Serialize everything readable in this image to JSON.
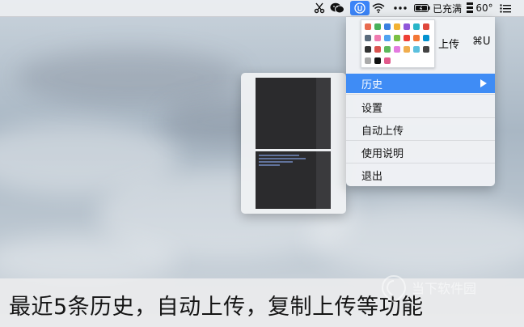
{
  "menubar": {
    "battery_status": "已充满",
    "temperature": "60°",
    "icons": [
      "scissors-icon",
      "wechat-icon",
      "uploader-app-icon",
      "wifi-icon",
      "more-dots-icon",
      "battery-icon",
      "weather-app-icon",
      "list-menu-icon"
    ]
  },
  "menu": {
    "upload_label": "上传",
    "upload_shortcut": "⌘U",
    "items": [
      {
        "label": "历史",
        "selected": true,
        "has_submenu": true
      },
      {
        "label": "设置"
      },
      {
        "label": "自动上传"
      },
      {
        "label": "使用说明"
      },
      {
        "label": "退出"
      }
    ]
  },
  "history": {
    "entries": [
      "history-item-1",
      "history-item-2"
    ]
  },
  "caption": "最近5条历史，自动上传，复制上传等功能",
  "watermark": "当下软件园",
  "colors": {
    "accent": "#3f8cf5",
    "menubar_active": "#3b84f7"
  }
}
